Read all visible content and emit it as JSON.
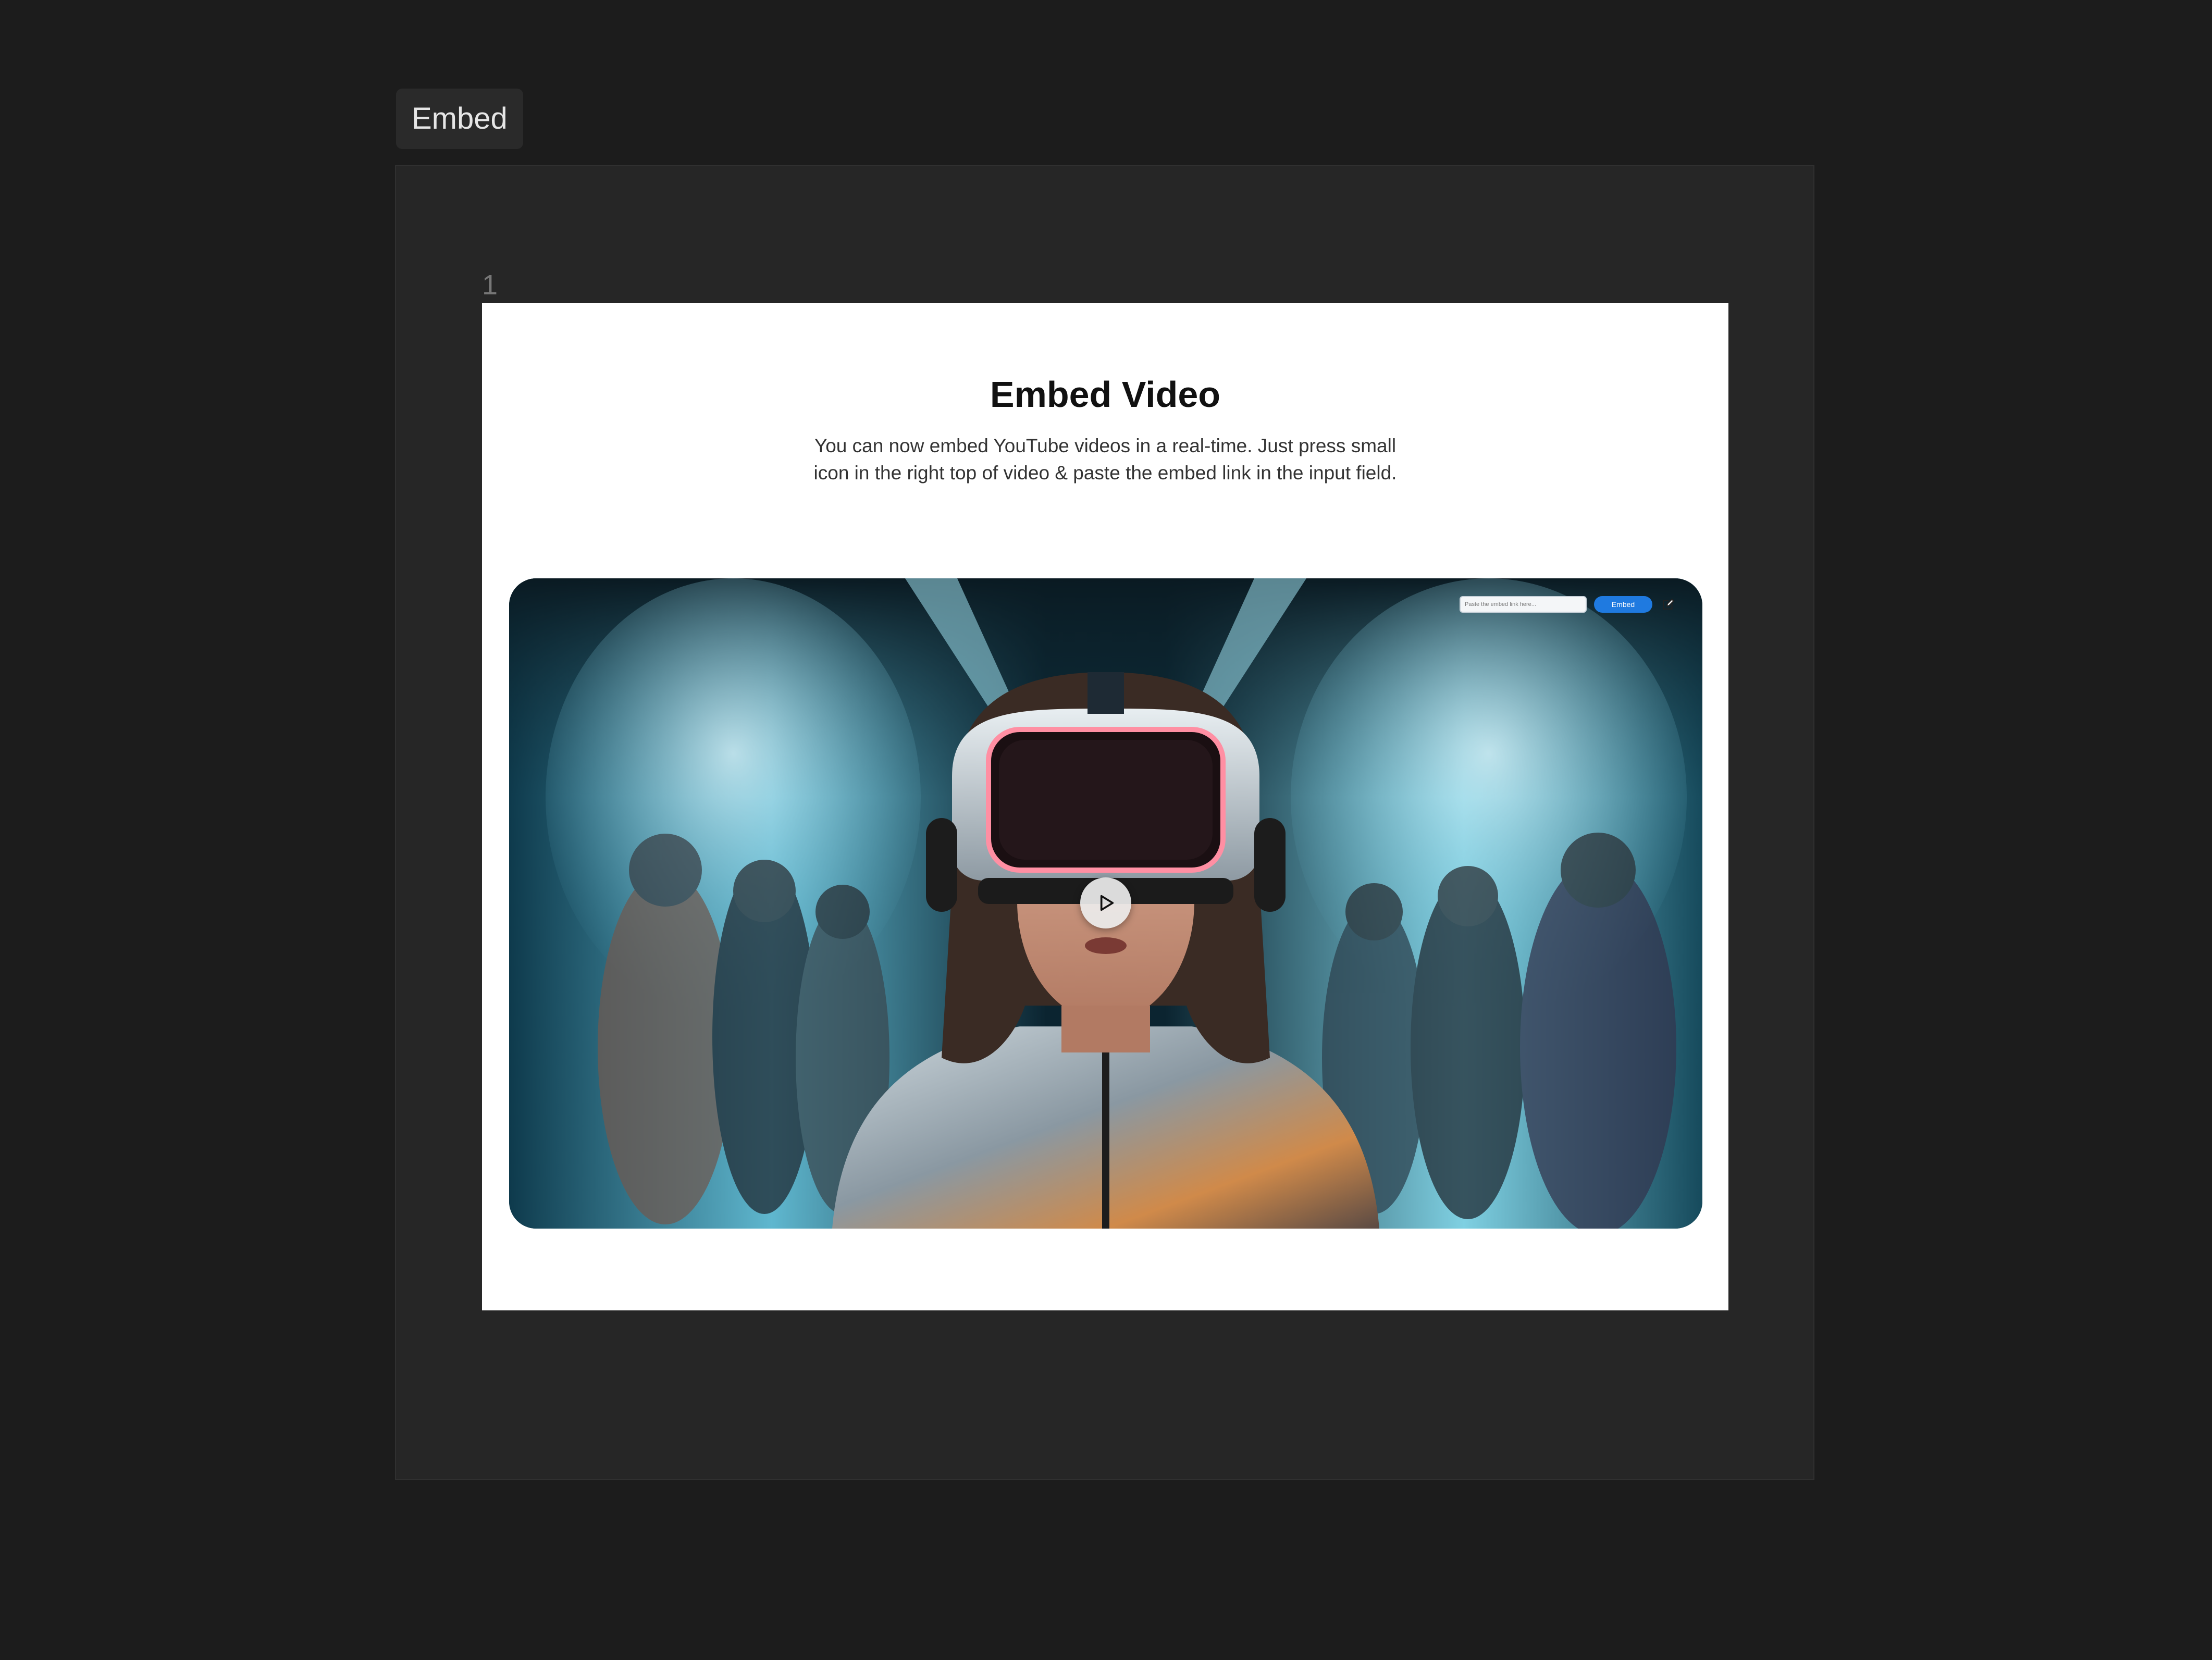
{
  "tag": {
    "label": "Embed"
  },
  "frame": {
    "page_number": "1"
  },
  "content": {
    "title": "Embed Video",
    "description": "You can now embed YouTube videos in a real-time. Just press small icon in the right top of video & paste the embed link in the input field."
  },
  "video": {
    "embed_input_placeholder": "Paste the embed link here...",
    "embed_button_label": "Embed",
    "accent_color": "#1f7ae0",
    "icons": {
      "edit": "edit-icon",
      "play": "play-icon"
    }
  },
  "colors": {
    "background": "#1c1c1c",
    "frame": "#262626",
    "artboard": "#ffffff"
  }
}
